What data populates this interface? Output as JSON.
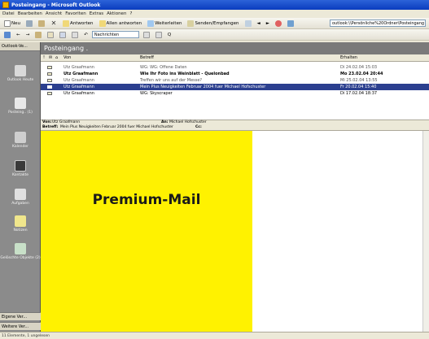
{
  "window": {
    "title": "Posteingang - Microsoft Outlook"
  },
  "menu": [
    "Datei",
    "Bearbeiten",
    "Ansicht",
    "Favoriten",
    "Extras",
    "Aktionen",
    "?"
  ],
  "toolbar1": {
    "new_label": "Neu",
    "reply_label": "Antworten",
    "reply_all_label": "Allen antworten",
    "forward_label": "Weiterleiten",
    "send_receive_label": "Senden/Empfangen",
    "address": "outlook:\\\\Persönliche%20Ordner\\Posteingang"
  },
  "toolbar2": {
    "view_select": "Nachrichten"
  },
  "outlook_bar": {
    "header": "Outlook-Ve...",
    "items": [
      {
        "label": "Outlook Heute",
        "icon": "outlook-today-icon",
        "color": "#d9d9d9"
      },
      {
        "label": "Posteing.. (1)",
        "icon": "inbox-icon",
        "color": "#e8e8e8"
      },
      {
        "label": "Kalender",
        "icon": "calendar-icon",
        "color": "#cfcfcf"
      },
      {
        "label": "Kontakte",
        "icon": "contacts-icon",
        "color": "#3a3a3a"
      },
      {
        "label": "Aufgaben",
        "icon": "tasks-icon",
        "color": "#e0e0e0"
      },
      {
        "label": "Notizen",
        "icon": "notes-icon",
        "color": "#f0e68c"
      },
      {
        "label": "Gelöschte Objekte (2)",
        "icon": "deleted-items-icon",
        "color": "#c8e0c8"
      }
    ],
    "footer1": "Eigene Ver...",
    "footer2": "Weitere Ver..."
  },
  "banner": {
    "title": "Posteingang ."
  },
  "list": {
    "columns": {
      "from": "Von",
      "subject": "Betreff",
      "date": "Erhalten"
    },
    "rows": [
      {
        "from": "Utz Graafmann",
        "subject": "WG: WG: Offene Daten",
        "date": "Di 24.02.04 15:03",
        "state": "gray"
      },
      {
        "from": "Utz Graafmann",
        "subject": "Wie Ihr Foto ins Weinblatt - Quelonbad",
        "date": "Mo 23.02.04 20:44",
        "state": "bold"
      },
      {
        "from": "Utz Graafmann",
        "subject": "Treffen wir uns auf der Messe?",
        "date": "Mi 25.02.04 13:55",
        "state": "gray"
      },
      {
        "from": "Utz Graafmann",
        "subject": "Mein Plus Neuigkeiten Februar 2004 fuer Michael Hofschuster",
        "date": "Fr 20.02.04 15:40",
        "state": "sel"
      },
      {
        "from": "Utz Graafmann",
        "subject": "WG: Skyscraper",
        "date": "Di 17.02.04 18:37",
        "state": "normal"
      }
    ]
  },
  "preview_header": {
    "from_label": "Von:",
    "from_value": "Utz Graafmann",
    "to_label": "An:",
    "to_value": "Michael Hofschuster",
    "subject_label": "Betreff:",
    "subject_value": "Mein Plus Neuigkeiten Februar 2004 fuer Michael Hofschuster",
    "cc_label": "Cc:"
  },
  "preview": {
    "ad_text": "Premium-Mail",
    "ad_color": "#fff200"
  },
  "status": {
    "text": "11 Elemente, 1 ungelesen"
  }
}
